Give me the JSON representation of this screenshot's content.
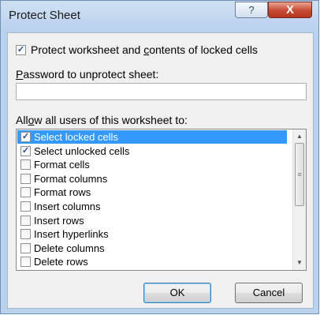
{
  "window": {
    "title": "Protect Sheet",
    "help_glyph": "?",
    "close_glyph": "X"
  },
  "protect": {
    "checked": true,
    "label_pre": "Protect worksheet and ",
    "label_u": "c",
    "label_post": "ontents of locked cells"
  },
  "password": {
    "label_u": "P",
    "label_post": "assword to unprotect sheet:",
    "value": ""
  },
  "allow": {
    "label_pre": "All",
    "label_u": "o",
    "label_post": "w all users of this worksheet to:"
  },
  "permissions": [
    {
      "label": "Select locked cells",
      "checked": true,
      "selected": true
    },
    {
      "label": "Select unlocked cells",
      "checked": true,
      "selected": false
    },
    {
      "label": "Format cells",
      "checked": false,
      "selected": false
    },
    {
      "label": "Format columns",
      "checked": false,
      "selected": false
    },
    {
      "label": "Format rows",
      "checked": false,
      "selected": false
    },
    {
      "label": "Insert columns",
      "checked": false,
      "selected": false
    },
    {
      "label": "Insert rows",
      "checked": false,
      "selected": false
    },
    {
      "label": "Insert hyperlinks",
      "checked": false,
      "selected": false
    },
    {
      "label": "Delete columns",
      "checked": false,
      "selected": false
    },
    {
      "label": "Delete rows",
      "checked": false,
      "selected": false
    }
  ],
  "buttons": {
    "ok": "OK",
    "cancel": "Cancel"
  },
  "colors": {
    "selection": "#3399ff",
    "title_gradient": "#b9d1ec",
    "close_button": "#c74a33"
  },
  "icons": {
    "check": "check-icon",
    "scroll_up": "arrow-up-icon",
    "scroll_down": "arrow-down-icon",
    "scroll_grip": "grip-icon"
  }
}
